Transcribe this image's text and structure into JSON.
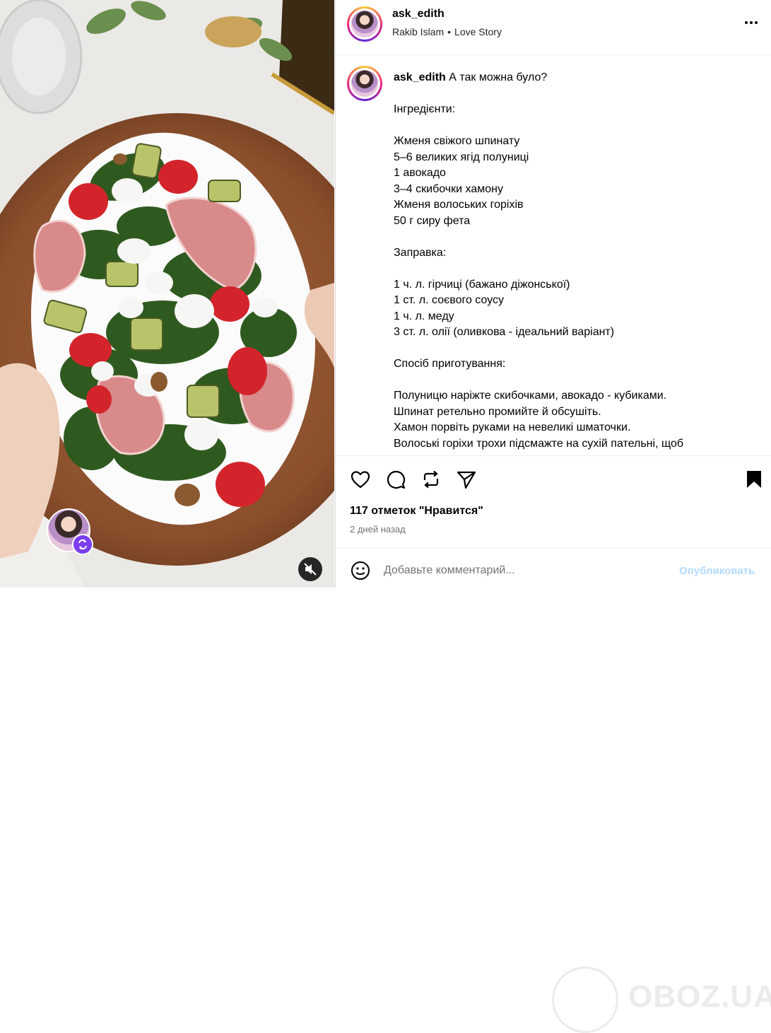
{
  "post": {
    "username": "ask_edith",
    "audio_artist": "Rakib Islam",
    "audio_track": "Love Story",
    "caption_username": "ask_edith",
    "caption_text": "А так можна було?\n\nІнгредієнти:\n\nЖменя свіжого шпинату\n5–6 великих ягід полуниці\n1 авокадо\n3–4 скибочки хамону\nЖменя волоських горіхів\n50 г сиру фета\n\nЗаправка:\n\n1 ч. л. гірчиці (бажано діжонської)\n1 ст. л. соєвого соусу\n1 ч. л. меду\n3 ст. л. олії (оливкова - ідеальний варіант)\n\nСпосіб приготування:\n\nПолуницю наріжте скибочками, авокадо - кубиками.\nШпинат ретельно промийте й обсушіть.\nХамон порвіть руками на невеликі шматочки.\nВолоські горіхи трохи підсмажте на сухій пательні, щоб",
    "likes": "117 отметок \"Нравится\"",
    "time_ago": "2 дней назад"
  },
  "comment": {
    "placeholder": "Добавьте комментарий...",
    "post_label": "Опубликовать"
  },
  "watermark": {
    "text": "OBOZ.UA"
  },
  "icons": {
    "more": "more-options-icon",
    "like": "heart-icon",
    "comment": "comment-icon",
    "share": "repost-icon",
    "send": "send-icon",
    "save": "bookmark-icon",
    "emoji": "emoji-icon",
    "mute": "muted-speaker-icon",
    "remix": "remix-icon"
  },
  "colors": {
    "post_button": "#b3dbff",
    "muted_text": "#737373",
    "border": "#dbdbdb"
  }
}
